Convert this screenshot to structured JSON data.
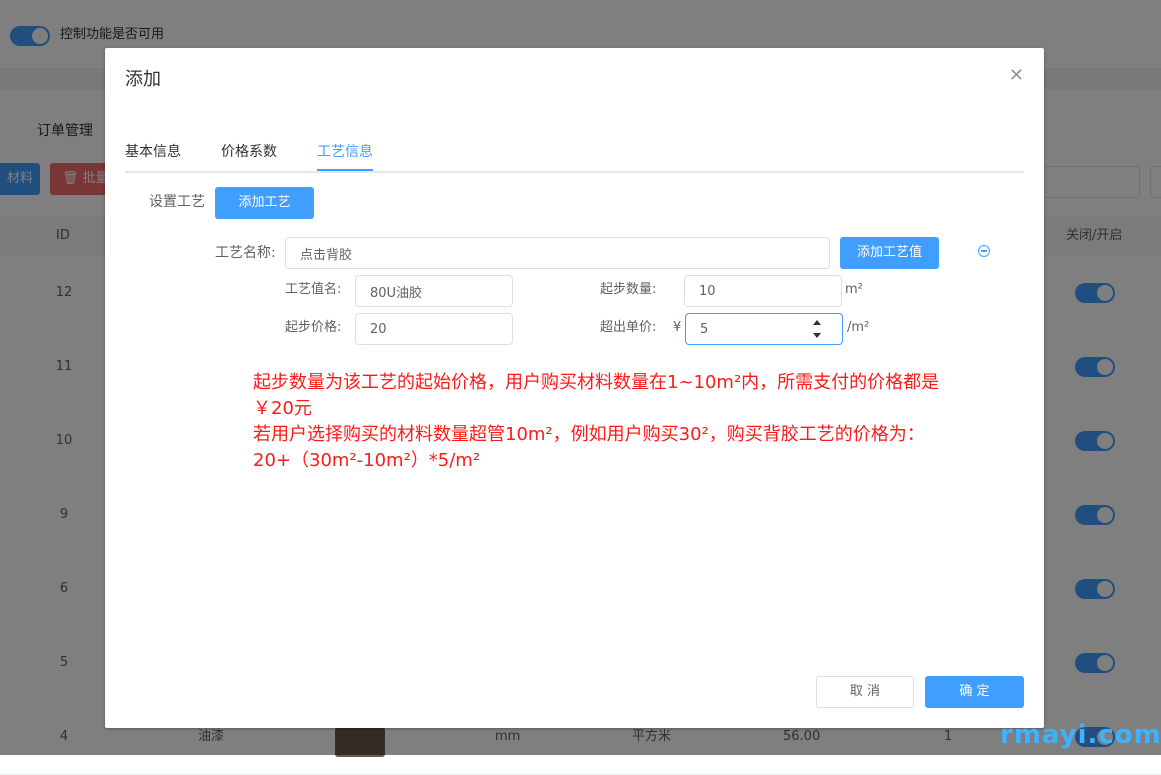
{
  "background": {
    "toggle_label": "控制功能是否可用",
    "nav_tab": "订单管理",
    "btn_material": "材料",
    "btn_batch": "批量",
    "batch_icon": "trash-icon",
    "table_headers": {
      "id": "ID",
      "toggle": "关闭/开启"
    },
    "rows": [
      {
        "id": "12"
      },
      {
        "id": "11"
      },
      {
        "id": "10"
      },
      {
        "id": "9"
      },
      {
        "id": "6"
      },
      {
        "id": "5"
      },
      {
        "id": "4",
        "name": "油漆",
        "unit": "mm",
        "area_unit": "平方米",
        "price": "56.00",
        "qty": "1"
      }
    ]
  },
  "dialog": {
    "title": "添加",
    "close_icon": "close-icon",
    "tabs": [
      "基本信息",
      "价格系数",
      "工艺信息"
    ],
    "active_tab": 2,
    "set_craft_label": "设置工艺",
    "add_craft_button": "添加工艺",
    "craft_name_label": "工艺名称:",
    "craft_name_value": "点击背胶",
    "add_craft_value_button": "添加工艺值",
    "craft_value_name_label": "工艺值名:",
    "craft_value_name_value": "80U油胶",
    "start_qty_label": "起步数量:",
    "start_qty_value": "10",
    "start_qty_unit": "m²",
    "start_price_label": "起步价格:",
    "start_price_value": "20",
    "excess_price_label": "超出单价:",
    "currency": "¥",
    "excess_price_value": "5",
    "excess_price_unit": "/m²",
    "note_lines": [
      "起步数量为该工艺的起始价格，用户购买材料数量在1~10m²内，所需支付的价格都是",
      "￥20元",
      "若用户选择购买的材料数量超管10m²，例如用户购买30²，购买背胶工艺的价格为：",
      "20+（30m²-10m²）*5/m²"
    ],
    "cancel_button": "取 消",
    "confirm_button": "确 定"
  },
  "watermark": "rmayi.com",
  "colors": {
    "primary": "#409eff",
    "danger": "#f56c6c",
    "note": "#ff1a1a"
  }
}
